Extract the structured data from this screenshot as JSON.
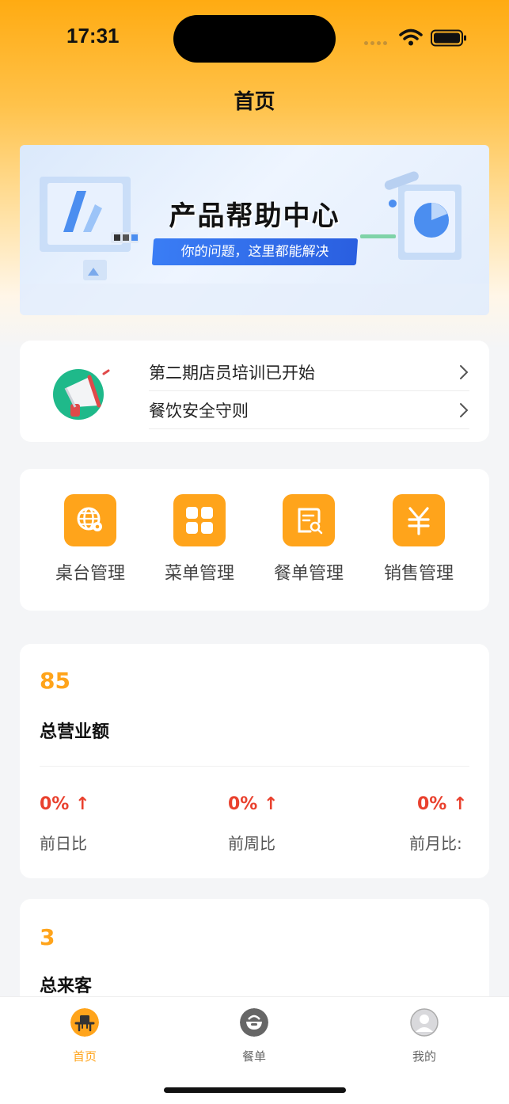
{
  "status": {
    "time": "17:31"
  },
  "nav": {
    "title": "首页"
  },
  "banner": {
    "title": "产品帮助中心",
    "subtitle": "你的问题，这里都能解决"
  },
  "notices": [
    {
      "text": "第二期店员培训已开始"
    },
    {
      "text": "餐饮安全守则"
    }
  ],
  "menu": [
    {
      "label": "桌台管理",
      "icon": "globe-pin-icon"
    },
    {
      "label": "菜单管理",
      "icon": "grid-icon"
    },
    {
      "label": "餐单管理",
      "icon": "receipt-search-icon"
    },
    {
      "label": "销售管理",
      "icon": "yen-icon"
    }
  ],
  "revenue": {
    "value": "85",
    "label": "总营业额",
    "comparisons": [
      {
        "pct": "0%",
        "label": "前日比"
      },
      {
        "pct": "0%",
        "label": "前周比"
      },
      {
        "pct": "0%",
        "label": "前月比:"
      }
    ]
  },
  "visitors": {
    "value": "3",
    "label": "总来客"
  },
  "tabs": [
    {
      "label": "首页",
      "active": true
    },
    {
      "label": "餐单",
      "active": false
    },
    {
      "label": "我的",
      "active": false
    }
  ],
  "colors": {
    "accent": "#ffa41b",
    "up": "#e9412e",
    "inactive": "#666666"
  }
}
